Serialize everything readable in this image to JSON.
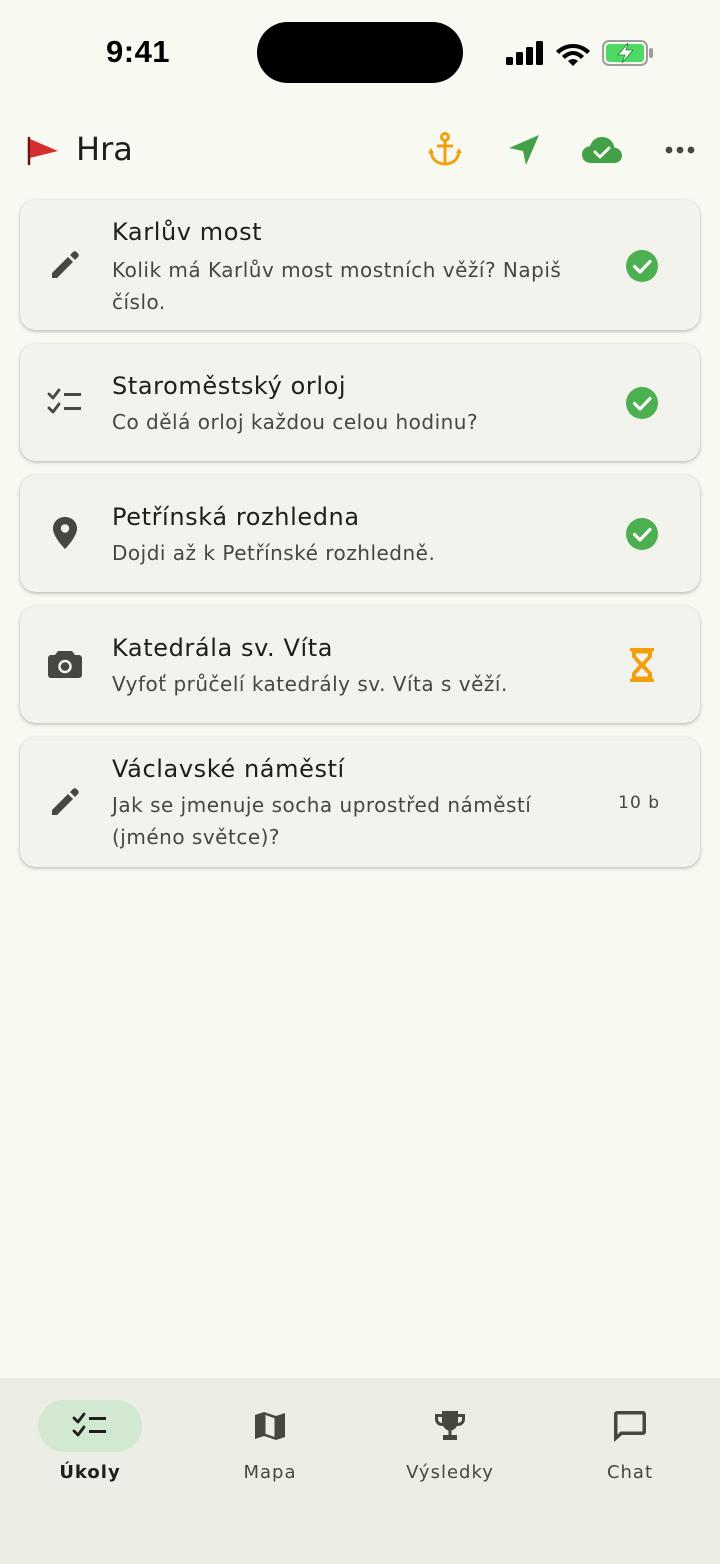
{
  "status_bar": {
    "time": "9:41"
  },
  "app_bar": {
    "title": "Hra",
    "icons": [
      "flag-icon",
      "anchor-icon",
      "navigation-icon",
      "cloud-done-icon",
      "more-icon"
    ]
  },
  "tasks": [
    {
      "title": "Karlův most",
      "description": "Kolik má Karlův most mostních věží? Napiš číslo.",
      "type_icon": "edit-icon",
      "status": "done"
    },
    {
      "title": "Staroměstský orloj",
      "description": "Co dělá orloj každou celou hodinu?",
      "type_icon": "checklist-icon",
      "status": "done"
    },
    {
      "title": "Petřínská rozhledna",
      "description": "Dojdi až k Petřínské rozhledně.",
      "type_icon": "location-pin-icon",
      "status": "done"
    },
    {
      "title": "Katedrála sv. Víta",
      "description": "Vyfoť průčelí katedrály sv. Víta s věží.",
      "type_icon": "camera-icon",
      "status": "pending"
    },
    {
      "title": "Václavské náměstí",
      "description": "Jak se jmenuje socha uprostřed náměstí (jméno světce)?",
      "type_icon": "edit-icon",
      "status": "open",
      "points": "10 b"
    }
  ],
  "bottom_nav": {
    "items": [
      {
        "label": "Úkoly",
        "icon": "checklist-icon",
        "active": true
      },
      {
        "label": "Mapa",
        "icon": "map-icon",
        "active": false
      },
      {
        "label": "Výsledky",
        "icon": "trophy-icon",
        "active": false
      },
      {
        "label": "Chat",
        "icon": "chat-icon",
        "active": false
      }
    ]
  },
  "colors": {
    "background": "#f8faf1",
    "card": "#f1f3ec",
    "success": "#4caf50",
    "pending": "#f59e0b",
    "flag": "#d32f2f",
    "nav_active_pill": "#d3e8d0"
  }
}
